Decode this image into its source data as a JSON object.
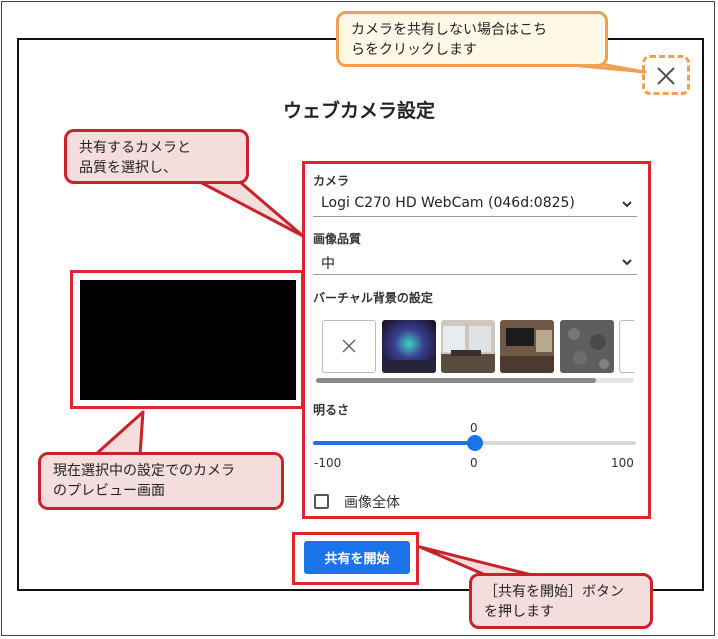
{
  "dialog": {
    "title": "ウェブカメラ設定",
    "camera_label": "カメラ",
    "camera_value": "Logi C270 HD WebCam (046d:0825)",
    "quality_label": "画像品質",
    "quality_value": "中",
    "virtual_bg_label": "バーチャル背景の設定",
    "brightness_label": "明るさ",
    "brightness_value": "0",
    "brightness_min": "-100",
    "brightness_mid": "0",
    "brightness_max": "100",
    "brightness_level": 0,
    "full_image_label": "画像全体",
    "start_button_label": "共有を開始"
  },
  "callouts": {
    "close_hint_line1": "カメラを共有しない場合はこち",
    "close_hint_line2": "らをクリックします",
    "select_hint_line1": "共有するカメラと",
    "select_hint_line2": "品質を選択し、",
    "preview_hint_line1": "現在選択中の設定でのカメラ",
    "preview_hint_line2": "のプレビュー画面",
    "start_hint_line1": "［共有を開始］ボタン",
    "start_hint_line2": "を押します"
  },
  "colors": {
    "accent": "#1a73e8",
    "highlight_red": "#e0252c",
    "highlight_orange": "#f0a050",
    "callout_fill": "#f4dedd"
  },
  "icons": {
    "close": "close-icon",
    "dropdown": "chevron-down-icon",
    "no_background": "no-background-icon"
  }
}
